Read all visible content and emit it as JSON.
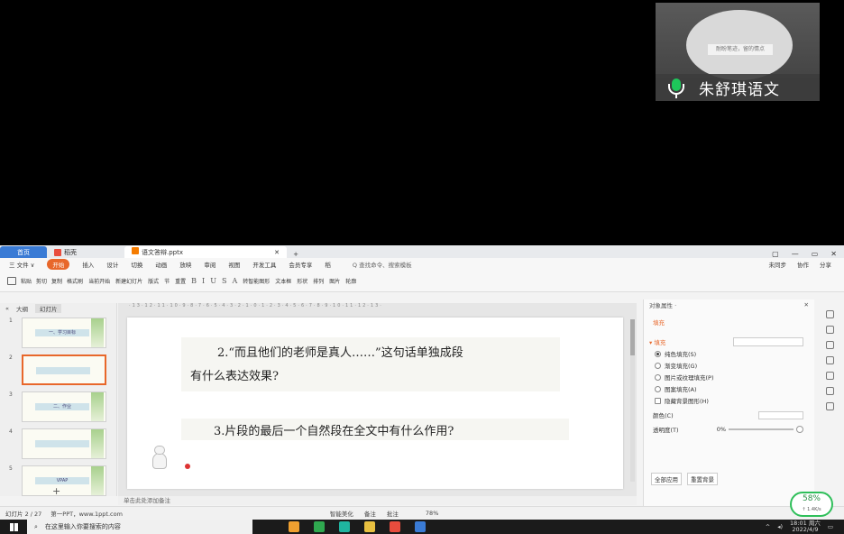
{
  "camera": {
    "name": "朱舒琪语文",
    "sign": "耐盼笔迹，留的情点"
  },
  "tabs": {
    "home": "首页",
    "daoke": "稻壳",
    "file": "语文答辩.pptx"
  },
  "menu": {
    "file": "三 文件 ∨",
    "start": "开始",
    "items": [
      "插入",
      "设计",
      "切换",
      "动画",
      "放映",
      "审阅",
      "视图",
      "开发工具",
      "会员专享",
      "稻"
    ],
    "search": "Q 查找命令、搜索模板",
    "right": [
      "未同步",
      "协作",
      "分享"
    ]
  },
  "ribbon": {
    "paste": "粘贴",
    "cut": "剪切",
    "copy": "复制",
    "format_painter": "格式刷",
    "from_current": "当前开始",
    "new_slide": "新建幻灯片",
    "layout": "版式",
    "section": "节",
    "reset": "重置",
    "textbox": "文本框",
    "shape": "形状",
    "arrange": "排列",
    "outline": "轮廓",
    "picture": "图片",
    "smartart": "转智能图形"
  },
  "left_panel": {
    "tab_outline": "大纲",
    "tab_slides": "幻灯片",
    "slides": [
      {
        "num": "1",
        "text": "一、学习目标"
      },
      {
        "num": "2",
        "text": ""
      },
      {
        "num": "3",
        "text": "二、作业"
      },
      {
        "num": "4",
        "text": ""
      },
      {
        "num": "5",
        "text": "VPAP"
      }
    ],
    "add": "+"
  },
  "slide": {
    "q1_line1": "2.“而且他们的老师是真人……”这句话单独成段",
    "q1_line2": "有什么表达效果?",
    "q2": "3.片段的最后一个自然段在全文中有什么作用?",
    "ruler": "·13·12·11·10·9·8·7·6·5·4·3·2·1·0·1·2·3·4·5·6·7·8·9·10·11·12·13·"
  },
  "pane": {
    "title": "对象属性 ·",
    "tab": "填充",
    "section": "▾ 填充",
    "options": [
      "纯色填充(S)",
      "渐变填充(G)",
      "图片或纹理填充(P)",
      "图案填充(A)",
      "隐藏背景图形(H)"
    ],
    "color_label": "颜色(C)",
    "transparency_label": "透明度(T)",
    "transparency_value": "0%",
    "apply_all": "全部应用",
    "reset_bg": "重置背景"
  },
  "notes": "单击此处添加备注",
  "status": {
    "slide_info": "幻灯片 2 / 27",
    "theme": "第一PPT，www.1ppt.com",
    "beautify": "智能美化",
    "notes_btn": "备注",
    "comment_btn": "批注",
    "zoom": "78%"
  },
  "speed": {
    "value": "58%",
    "rate": "↑ 1.4K/s"
  },
  "taskbar": {
    "search": "在这里输入你要搜索的内容",
    "time": "18:01 周六",
    "date": "2022/4/9"
  }
}
